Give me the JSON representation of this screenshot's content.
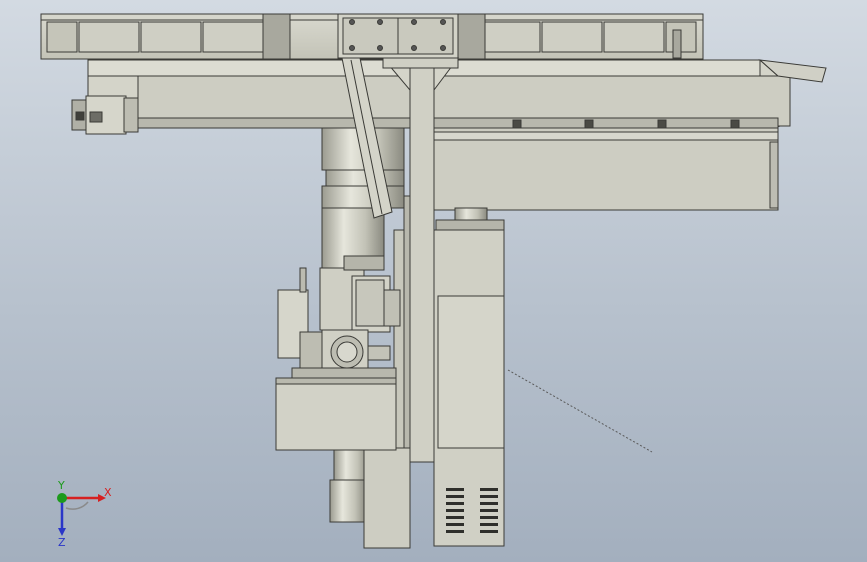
{
  "viewport": {
    "background_top": "#d3dae2",
    "background_bottom": "#a3afbe"
  },
  "model": {
    "part_color": "#c9c9bd",
    "part_dark": "#8f8f84",
    "edge_color": "#3a3a36"
  },
  "triad": {
    "x_label": "X",
    "y_label": "Y",
    "z_label": "Z",
    "x_color": "#d62020",
    "y_color": "#1c9a1c",
    "z_color": "#2a36c8"
  }
}
